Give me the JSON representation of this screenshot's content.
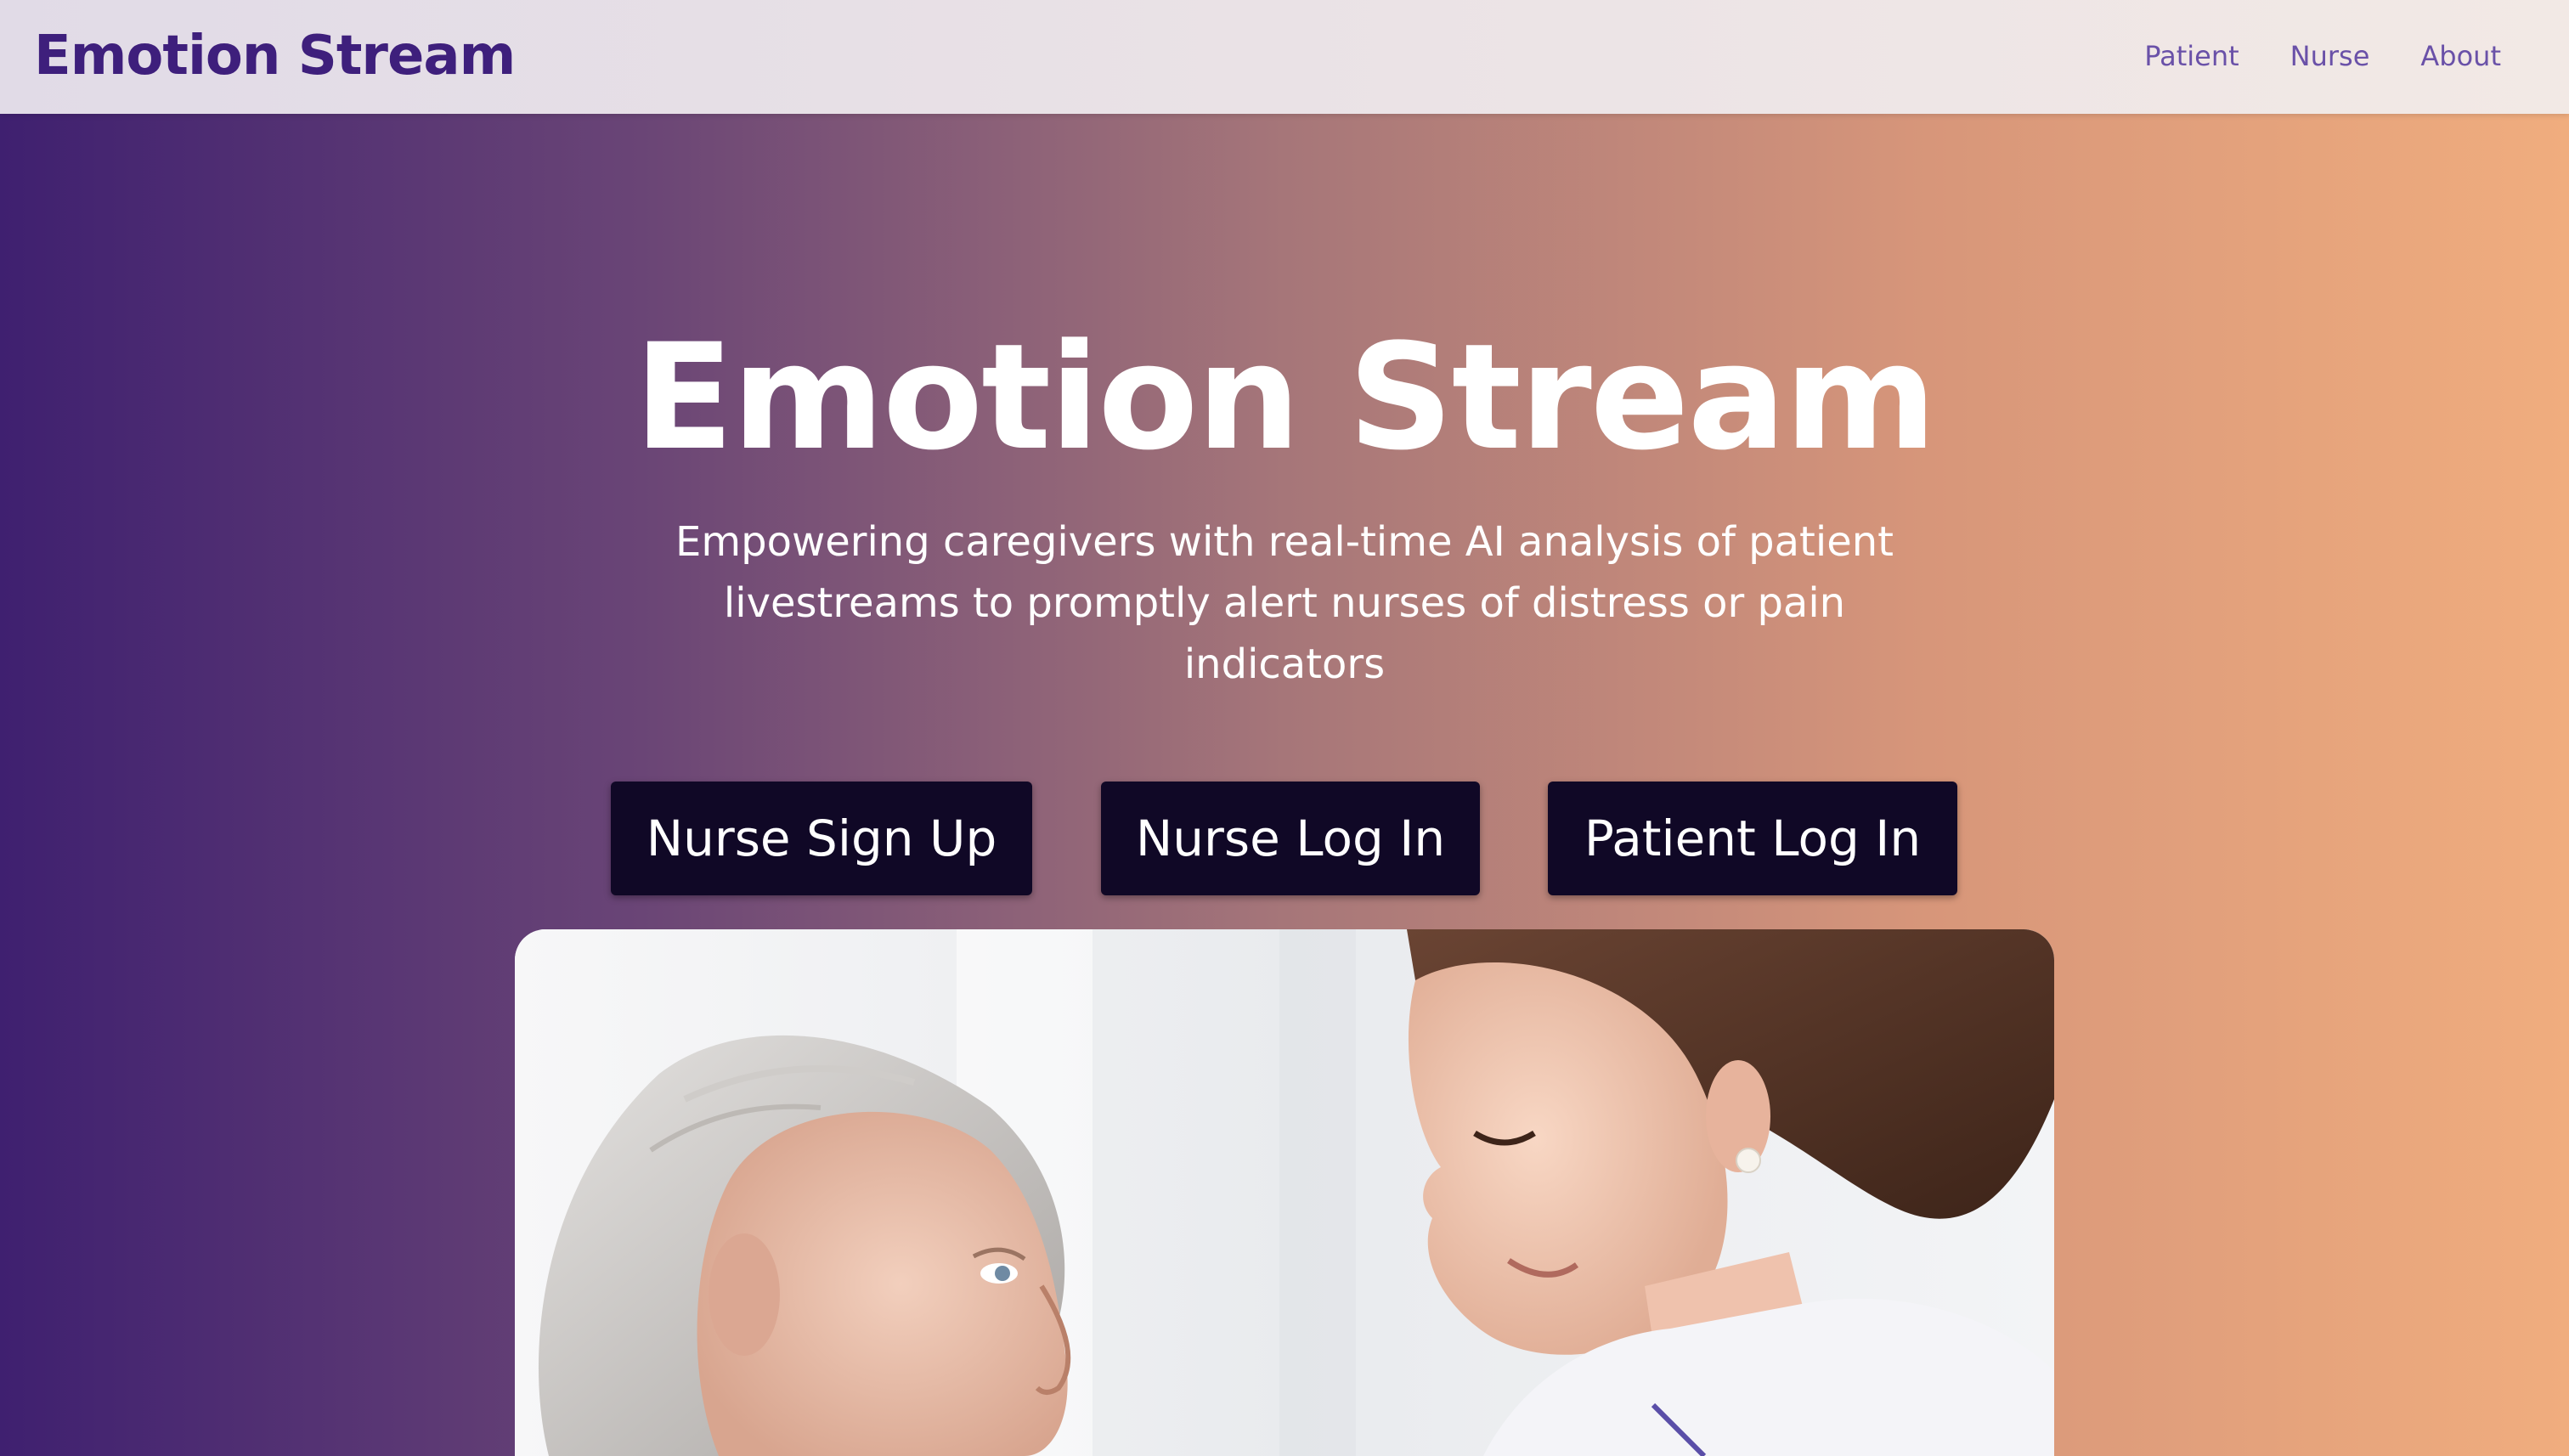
{
  "nav": {
    "brand": "Emotion Stream",
    "links": [
      {
        "label": "Patient"
      },
      {
        "label": "Nurse"
      },
      {
        "label": "About"
      }
    ]
  },
  "hero": {
    "title": "Emotion Stream",
    "subtitle": "Empowering caregivers with real-time AI analysis of patient livestreams to promptly alert nurses of distress or pain indicators"
  },
  "buttons": {
    "nurse_sign_up": "Nurse Sign Up",
    "nurse_log_in": "Nurse Log In",
    "patient_log_in": "Patient Log In"
  },
  "colors": {
    "brand": "#3e1f7c",
    "nav_link": "#6a51a8",
    "button_bg": "#100826",
    "gradient_start": "#3f2070",
    "gradient_end": "#f0ad7e"
  }
}
